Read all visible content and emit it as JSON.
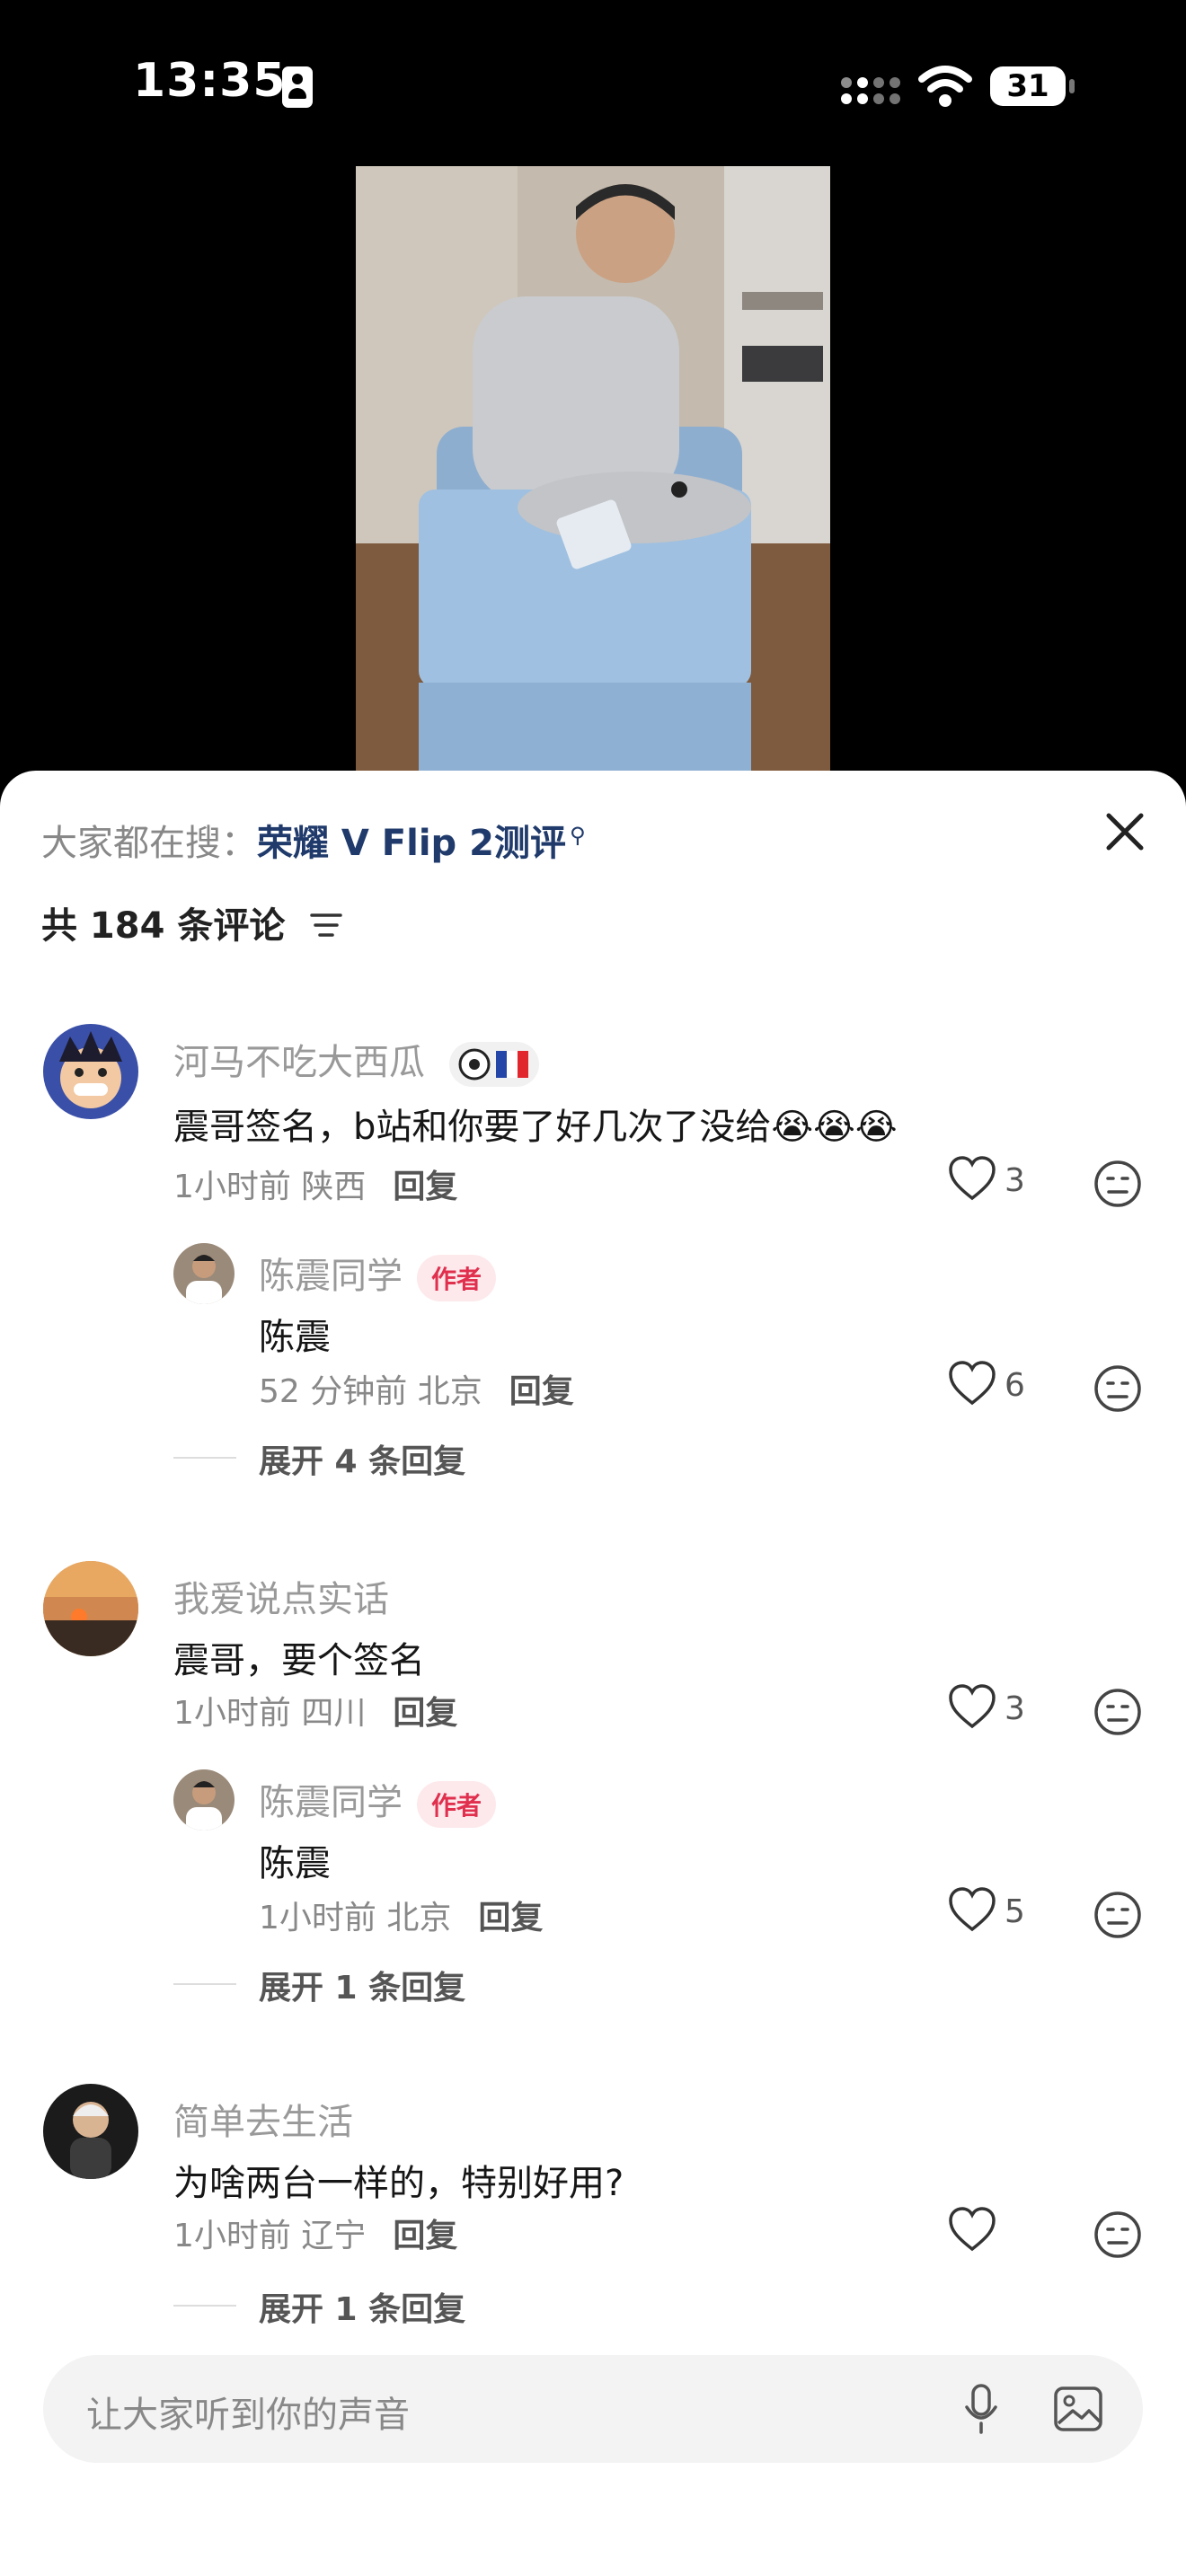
{
  "status_bar": {
    "time": "13:35",
    "battery": "31"
  },
  "search_suggest": {
    "prefix": "大家都在搜：",
    "keyword": "荣耀 V Flip 2测评"
  },
  "comments_header": {
    "count_text": "共 184 条评论"
  },
  "comments": [
    {
      "user": "河马不吃大西瓜",
      "text": "震哥签名，b站和你要了好几次了没给",
      "trailing_emoji": "😭😭😭",
      "time": "1小时前",
      "location": "陕西",
      "reply_label": "回复",
      "likes": "3",
      "reply": {
        "user": "陈震同学",
        "badge": "作者",
        "text": "陈震",
        "time": "52 分钟前",
        "location": "北京",
        "reply_label": "回复",
        "likes": "6"
      },
      "expand": "展开 4 条回复"
    },
    {
      "user": "我爱说点实话",
      "text": "震哥，要个签名",
      "time": "1小时前",
      "location": "四川",
      "reply_label": "回复",
      "likes": "3",
      "reply": {
        "user": "陈震同学",
        "badge": "作者",
        "text": "陈震",
        "time": "1小时前",
        "location": "北京",
        "reply_label": "回复",
        "likes": "5"
      },
      "expand": "展开 1 条回复"
    },
    {
      "user": "简单去生活",
      "text": "为啥两台一样的，特别好用?",
      "time": "1小时前",
      "location": "辽宁",
      "reply_label": "回复",
      "likes": "",
      "expand": "展开 1 条回复"
    }
  ],
  "input": {
    "placeholder": "让大家听到你的声音"
  },
  "colors": {
    "accent_red": "#e0304e",
    "keyword_blue": "#1f3a6b"
  }
}
